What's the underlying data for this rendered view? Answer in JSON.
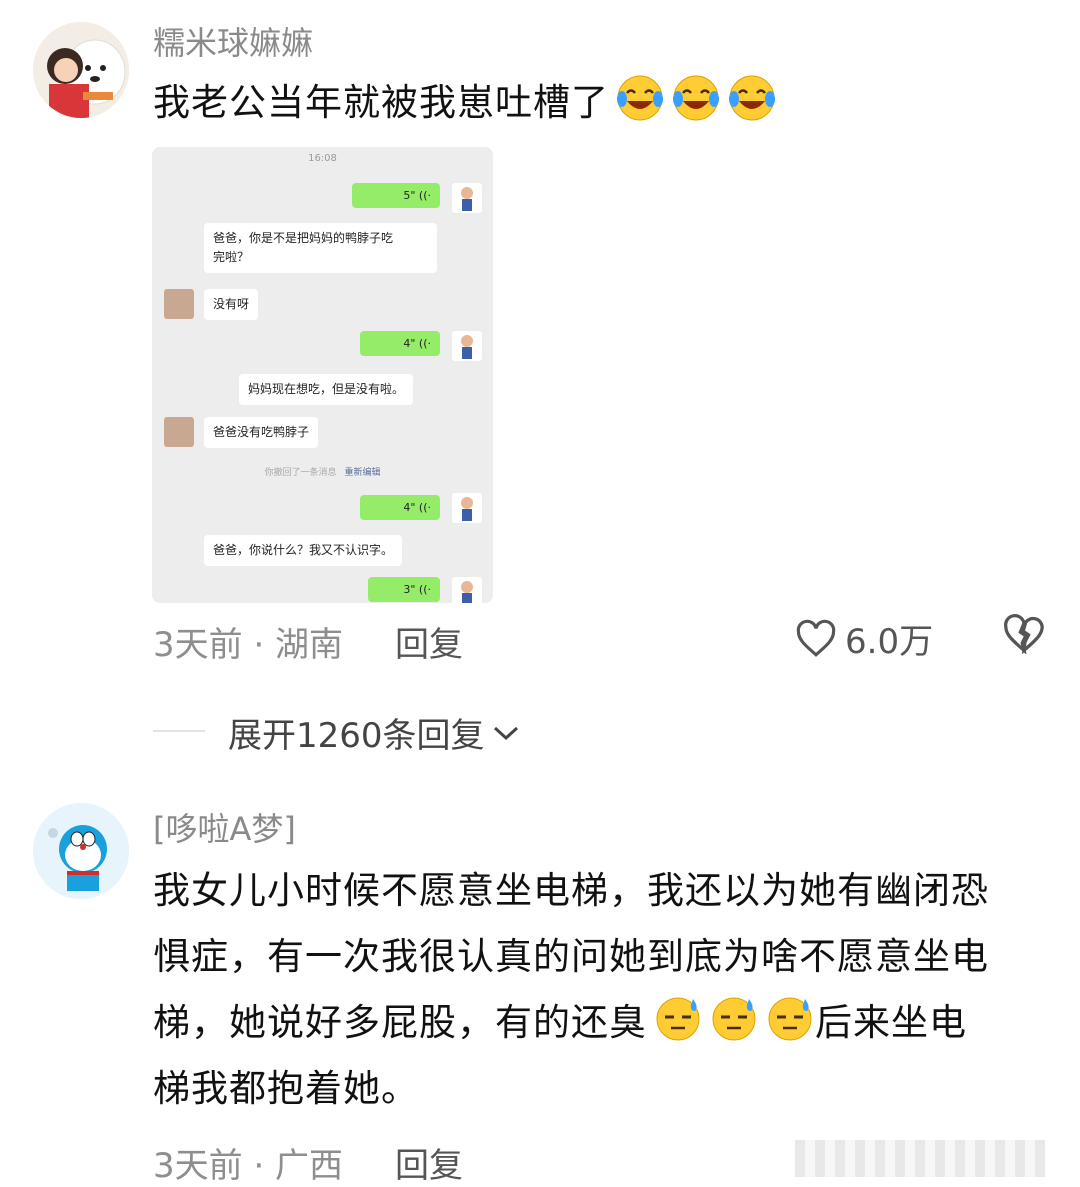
{
  "comments": [
    {
      "username": "糯米球嫲嫲",
      "text": "我老公当年就被我崽吐槽了",
      "emoji": "crying-laughing-face",
      "emoji_count": 3,
      "time_location": "3天前 · 湖南",
      "reply_label": "回复",
      "likes": "6.0万"
    },
    {
      "username": "[哆啦A梦]",
      "text_lines": [
        "我女儿小时候不愿意坐电梯，我还以为她有幽闭恐",
        "惧症，有一次我很认真的问她到底为啥不愿意坐电",
        "梯，她说好多屁股，有的还臭",
        "梯我都抱着她。"
      ],
      "text_line3_tail": "后来坐电",
      "emoji": "sweat-face",
      "emoji_count": 3,
      "time_location": "3天前 · 广西",
      "reply_label": "回复"
    }
  ],
  "expand_replies": "展开1260条回复",
  "chat": {
    "time": "16:08",
    "messages": [
      {
        "side": "right",
        "type": "voice",
        "duration": "5\""
      },
      {
        "side": "left",
        "type": "text",
        "lines": [
          "爸爸，你是不是把妈妈的鸭脖子吃",
          "完啦？"
        ]
      },
      {
        "side": "left",
        "type": "text",
        "text": "没有呀",
        "avatar": true
      },
      {
        "side": "right",
        "type": "voice",
        "duration": "4\""
      },
      {
        "side": "left",
        "type": "text",
        "text": "妈妈现在想吃，但是没有啦。"
      },
      {
        "side": "left",
        "type": "text",
        "text": "爸爸没有吃鸭脖子",
        "avatar": true
      },
      {
        "side": "system",
        "text": "你撤回了一条消息",
        "action": "重新编辑"
      },
      {
        "side": "right",
        "type": "voice",
        "duration": "4\""
      },
      {
        "side": "left",
        "type": "text",
        "text": "爸爸，你说什么？我又不认识字。"
      },
      {
        "side": "right",
        "type": "voice",
        "duration": "3\""
      }
    ]
  },
  "colors": {
    "wechat_green": "#95ec69",
    "chat_bg": "#ededed",
    "meta_gray": "#8e8e8e"
  }
}
